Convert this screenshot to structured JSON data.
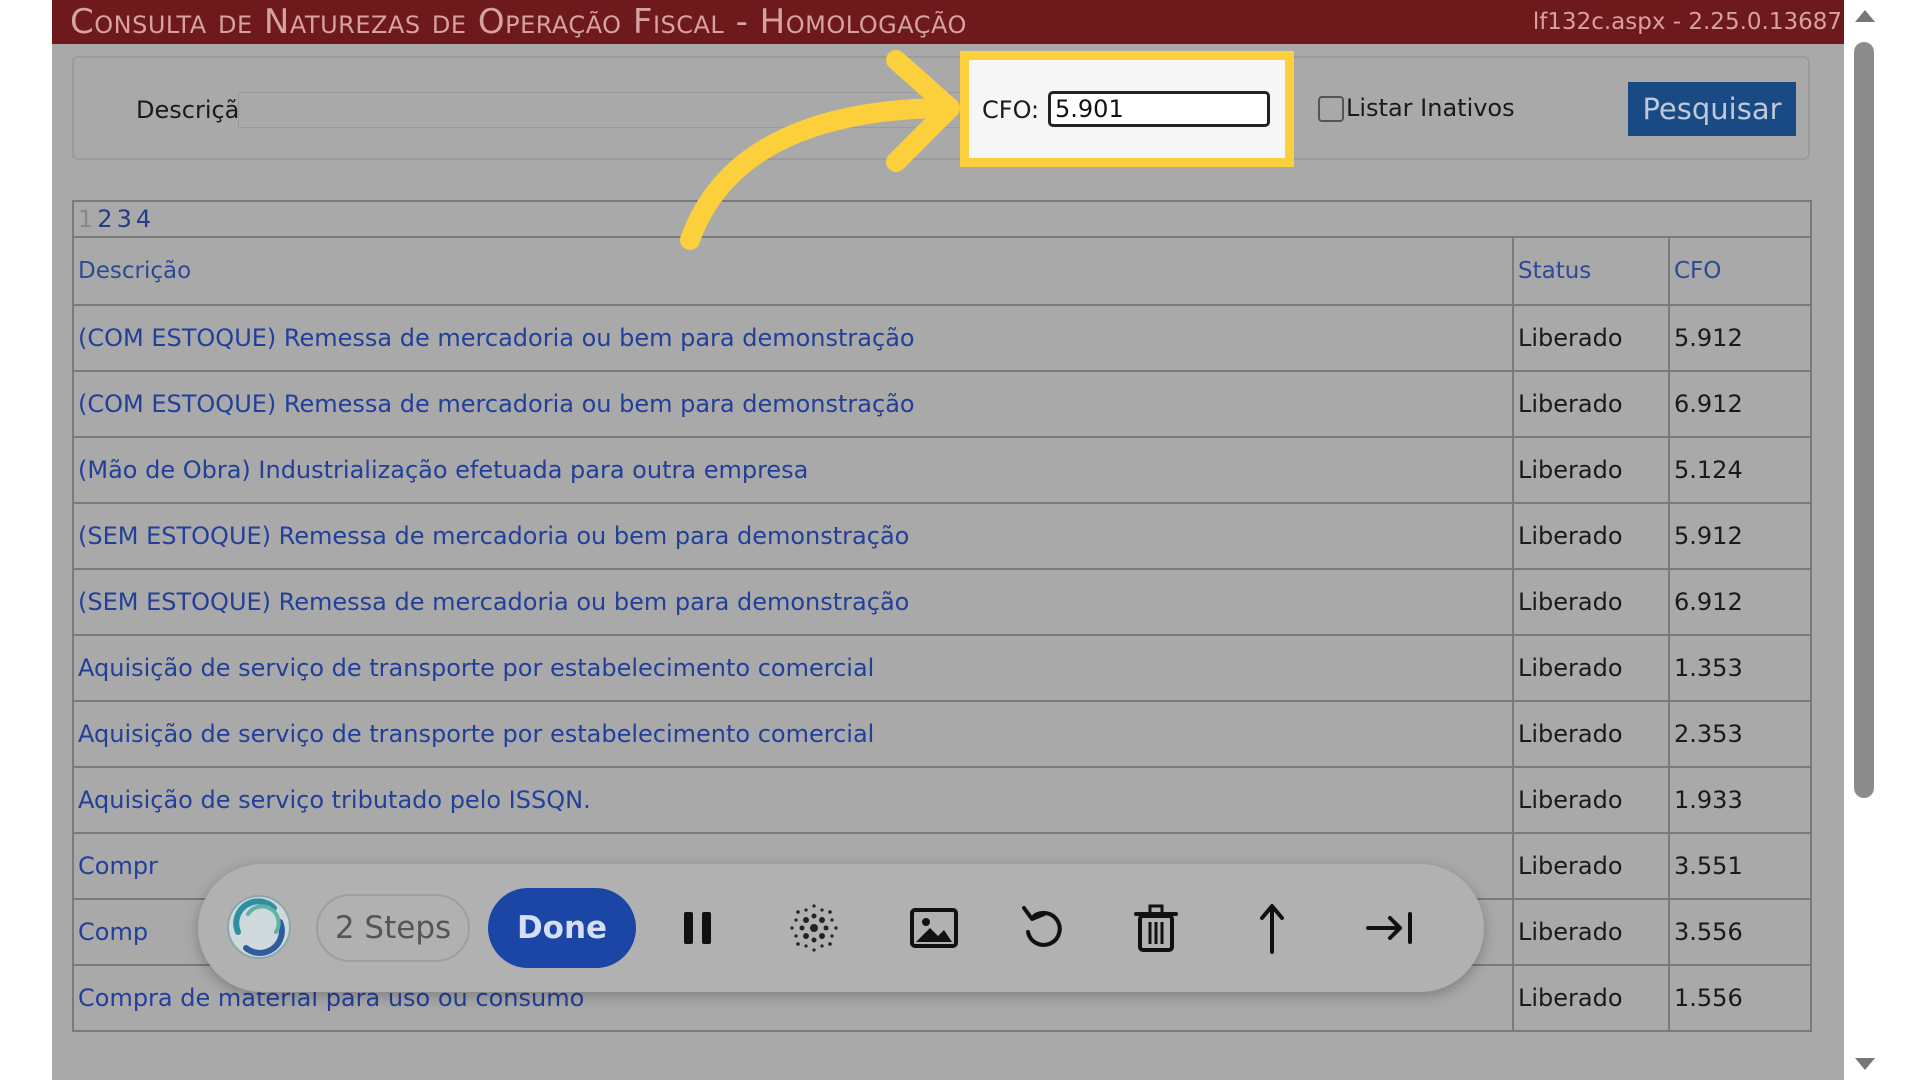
{
  "window": {
    "title": "Consulta de Naturezas de Operação Fiscal  - Homologação",
    "page_info": "lf132c.aspx - 2.25.0.13687"
  },
  "filters": {
    "descricao_label": "Descrição:",
    "descricao_value": "",
    "cfo_label": "CFO:",
    "cfo_value": "5.901",
    "listar_inativos_label": "Listar Inativos",
    "listar_inativos_checked": false,
    "search_label": "Pesquisar"
  },
  "pager": {
    "current": "1",
    "pages": [
      "2",
      "3",
      "4"
    ]
  },
  "table": {
    "headers": [
      "Descrição",
      "Status",
      "CFO"
    ],
    "rows": [
      {
        "descricao": "(COM ESTOQUE) Remessa de mercadoria ou bem para demonstração",
        "status": "Liberado",
        "cfo": "5.912"
      },
      {
        "descricao": "(COM ESTOQUE) Remessa de mercadoria ou bem para demonstração",
        "status": "Liberado",
        "cfo": "6.912"
      },
      {
        "descricao": "(Mão de Obra) Industrialização efetuada para outra empresa",
        "status": "Liberado",
        "cfo": "5.124"
      },
      {
        "descricao": "(SEM ESTOQUE) Remessa de mercadoria ou bem para demonstração",
        "status": "Liberado",
        "cfo": "5.912"
      },
      {
        "descricao": "(SEM ESTOQUE) Remessa de mercadoria ou bem para demonstração",
        "status": "Liberado",
        "cfo": "6.912"
      },
      {
        "descricao": "Aquisição de serviço de transporte por estabelecimento comercial",
        "status": "Liberado",
        "cfo": "1.353"
      },
      {
        "descricao": "Aquisição de serviço de transporte por estabelecimento comercial",
        "status": "Liberado",
        "cfo": "2.353"
      },
      {
        "descricao": "Aquisição de serviço tributado pelo ISSQN.",
        "status": "Liberado",
        "cfo": "1.933"
      },
      {
        "descricao": "Compr",
        "status": "Liberado",
        "cfo": "3.551"
      },
      {
        "descricao": "Comp",
        "status": "Liberado",
        "cfo": "3.556"
      },
      {
        "descricao": "Compra de material para uso ou consumo",
        "status": "Liberado",
        "cfo": "1.556"
      }
    ]
  },
  "recorder": {
    "steps_label": "2 Steps",
    "done_label": "Done",
    "tools": [
      "pause-icon",
      "blur-icon",
      "image-icon",
      "undo-icon",
      "trash-icon",
      "upload-arrow-icon",
      "skip-to-end-icon"
    ]
  },
  "colors": {
    "titlebar": "#6e1a1d",
    "highlight": "#fccf3c",
    "search_button": "#1a4a84",
    "done_button": "#1b46a6",
    "link": "#22409a"
  }
}
